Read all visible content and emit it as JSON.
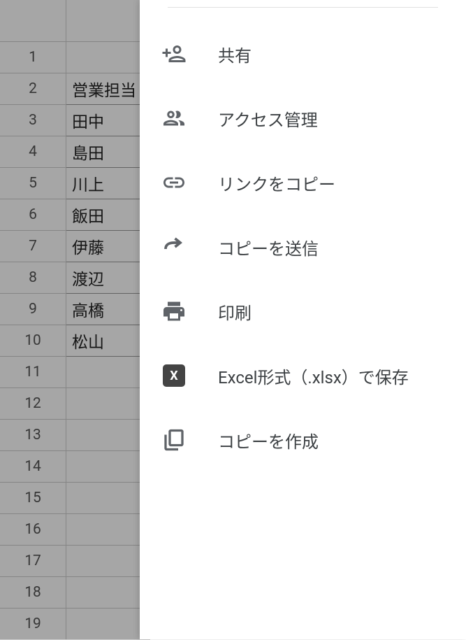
{
  "spreadsheet": {
    "row_numbers": [
      "1",
      "2",
      "3",
      "4",
      "5",
      "6",
      "7",
      "8",
      "9",
      "10",
      "11",
      "12",
      "13",
      "14",
      "15",
      "16",
      "17",
      "18",
      "19"
    ],
    "column_a": [
      "",
      "営業担当",
      "田中",
      "島田",
      "川上",
      "飯田",
      "伊藤",
      "渡辺",
      "高橋",
      "松山",
      "",
      "",
      "",
      "",
      "",
      "",
      "",
      "",
      ""
    ]
  },
  "menu": {
    "items": [
      {
        "label": "共有"
      },
      {
        "label": "アクセス管理"
      },
      {
        "label": "リンクをコピー"
      },
      {
        "label": "コピーを送信"
      },
      {
        "label": "印刷"
      },
      {
        "label": "Excel形式（.xlsx）で保存"
      },
      {
        "label": "コピーを作成"
      }
    ],
    "excel_badge": "X"
  }
}
